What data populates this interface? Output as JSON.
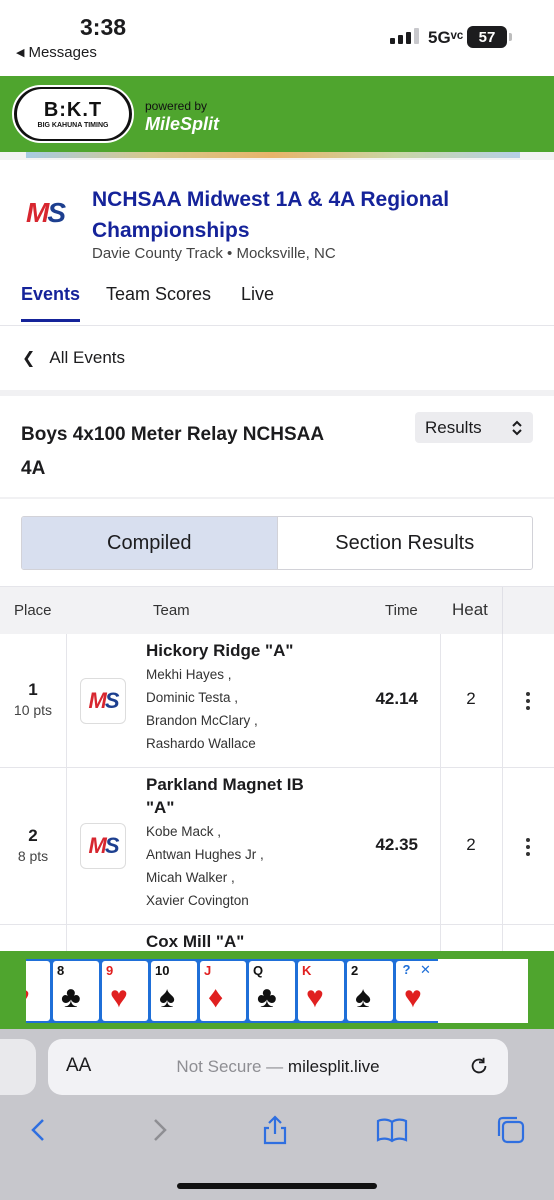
{
  "status_bar": {
    "time": "3:38",
    "back_app": "Messages",
    "network": "5Gᵛᶜ",
    "battery": "57"
  },
  "banner": {
    "logo_mark": "B:K.T",
    "logo_sub": "BIG KAHUNA TIMING",
    "powered_by": "powered by",
    "brand": "MileSplit"
  },
  "meet": {
    "logo": {
      "m": "M",
      "s": "S"
    },
    "title": "NCHSAA Midwest 1A & 4A Regional Championships",
    "location": "Davie County Track • Mocksville, NC"
  },
  "tabs": [
    {
      "label": "Events"
    },
    {
      "label": "Team Scores"
    },
    {
      "label": "Live"
    }
  ],
  "nav": {
    "all_events": "All Events"
  },
  "event": {
    "title": "Boys 4x100 Meter Relay NCHSAA 4A",
    "view_select": "Results"
  },
  "toggle": {
    "compiled": "Compiled",
    "section": "Section Results"
  },
  "table": {
    "headers": {
      "place": "Place",
      "team": "Team",
      "time": "Time",
      "heat": "Heat"
    },
    "rows": [
      {
        "place": "1",
        "points": "10 pts",
        "team": "Hickory Ridge \"A\"",
        "athletes": [
          "Mekhi Hayes ,",
          "Dominic Testa ,",
          "Brandon McClary ,",
          "Rashardo Wallace"
        ],
        "time": "42.14",
        "heat": "2"
      },
      {
        "place": "2",
        "points": "8 pts",
        "team": "Parkland Magnet IB \"A\"",
        "athletes": [
          "Kobe Mack ,",
          "Antwan Hughes Jr ,",
          "Micah Walker ,",
          "Xavier Covington"
        ],
        "time": "42.35",
        "heat": "2"
      },
      {
        "team": "Cox Mill \"A\""
      }
    ]
  },
  "ad": {
    "cards": [
      {
        "rank": "",
        "suit": "♥",
        "color": "red"
      },
      {
        "rank": "8",
        "suit": "♣",
        "color": "blk"
      },
      {
        "rank": "9",
        "suit": "♥",
        "color": "red"
      },
      {
        "rank": "10",
        "suit": "♠",
        "color": "blk"
      },
      {
        "rank": "J",
        "suit": "♦",
        "color": "red"
      },
      {
        "rank": "Q",
        "suit": "♣",
        "color": "blk"
      },
      {
        "rank": "K",
        "suit": "♥",
        "color": "red"
      },
      {
        "rank": "2",
        "suit": "♠",
        "color": "blk"
      },
      {
        "rank": "",
        "suit": "♥",
        "color": "red"
      }
    ],
    "info_icon": "?",
    "close_icon": "✕"
  },
  "browser": {
    "text_size_label": "AA",
    "security": "Not Secure — ",
    "domain": "milesplit.live"
  },
  "colors": {
    "accent_navy": "#15239a",
    "banner_green": "#4fa52e",
    "logo_red": "#d7262f",
    "logo_blue": "#1d3f8f"
  }
}
